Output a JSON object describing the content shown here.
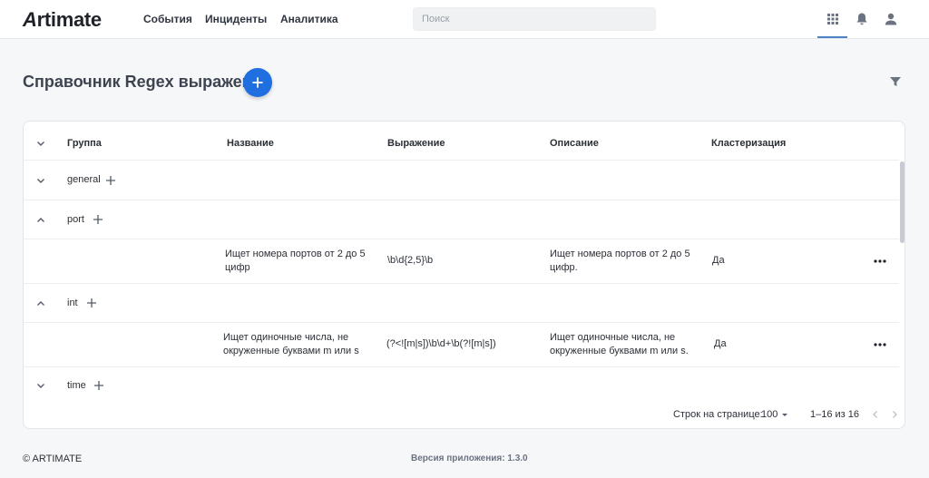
{
  "app": {
    "logo": "Artimate",
    "logo_first": "A",
    "logo_rest": "rtimate"
  },
  "nav": [
    {
      "label": "События"
    },
    {
      "label": "Инциденты"
    },
    {
      "label": "Аналитика"
    }
  ],
  "search": {
    "placeholder": "Поиск",
    "value": ""
  },
  "header_icons": [
    "apps-grid-icon",
    "bell-icon",
    "user-icon"
  ],
  "page": {
    "title": "Справочник Regex выражений"
  },
  "table": {
    "columns": [
      "Группа",
      "Название",
      "Выражение",
      "Описание",
      "Кластеризация"
    ],
    "groups": [
      {
        "name": "general",
        "expanded": false,
        "rows": []
      },
      {
        "name": "port",
        "expanded": true,
        "rows": [
          {
            "name": "Ищет номера портов от 2 до 5 цифр",
            "name_l1": "Ищет номера портов от 2 до 5",
            "name_l2": "цифр",
            "expression": "\\b\\d{2,5}\\b",
            "description_l1": "Ищет номера портов от 2 до 5",
            "description_l2": "цифр.",
            "clustering": "Да"
          }
        ]
      },
      {
        "name": "int",
        "expanded": true,
        "rows": [
          {
            "name_l1": "Ищет одиночные числа, не",
            "name_l2": "окруженные буквами m или s",
            "expression": "(?<![m|s])\\b\\d+\\b(?![m|s])",
            "description_l1": "Ищет одиночные числа, не",
            "description_l2": "окруженные буквами m или s.",
            "clustering": "Да"
          }
        ]
      },
      {
        "name": "time",
        "expanded": false,
        "rows": []
      }
    ]
  },
  "pagination": {
    "rows_per_page_label": "Строк на странице:",
    "rows_per_page_value": "100",
    "range": "1–16 из 16"
  },
  "footer": {
    "copyright": "© ARTIMATE",
    "version": "Версия приложения: 1.3.0"
  },
  "colors": {
    "accent": "#1f6fe0",
    "tab_indicator": "#4d83c4"
  }
}
